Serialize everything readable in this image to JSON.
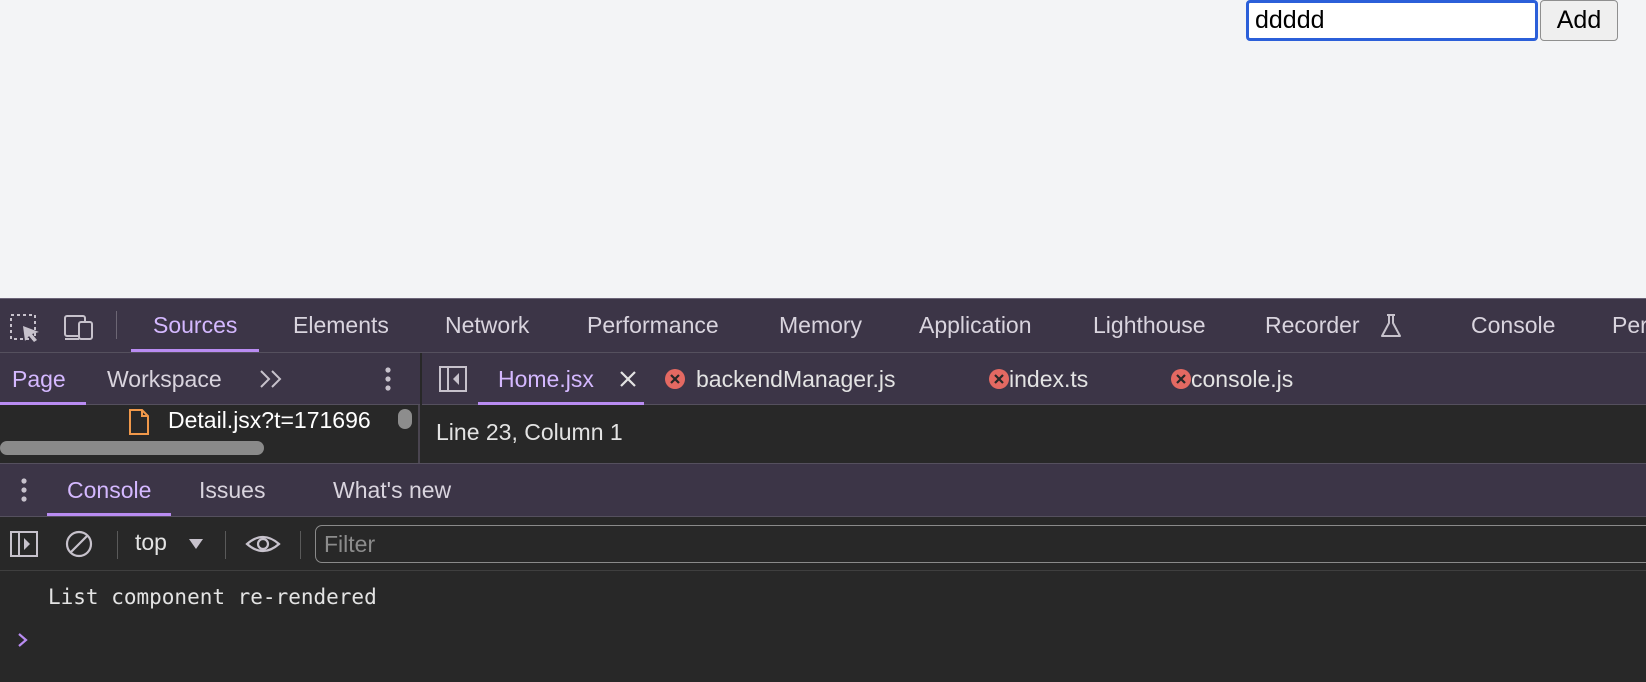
{
  "page": {
    "input_value": "ddddd",
    "add_label": "Add"
  },
  "devtools": {
    "main_tabs": [
      "Sources",
      "Elements",
      "Network",
      "Performance",
      "Memory",
      "Application",
      "Lighthouse",
      "Recorder",
      "Console",
      "Per"
    ],
    "active_main_tab": "Sources",
    "navigator": {
      "tabs": [
        "Page",
        "Workspace"
      ],
      "file": "Detail.jsx?t=171696"
    },
    "editor": {
      "tabs": [
        "Home.jsx",
        "backendManager.js",
        "index.ts",
        "console.js"
      ],
      "active_tab": "Home.jsx",
      "status": "Line 23, Column 1"
    },
    "drawer": {
      "tabs": [
        "Console",
        "Issues",
        "What's new"
      ],
      "context": "top",
      "filter_placeholder": "Filter",
      "log_message": "List component re-rendered"
    },
    "colors": {
      "accent": "#b98cf2",
      "active_text": "#d4b8ff",
      "tabbar_bg": "#3c3547",
      "panel_bg": "#282828",
      "error_icon": "#e46962"
    }
  }
}
